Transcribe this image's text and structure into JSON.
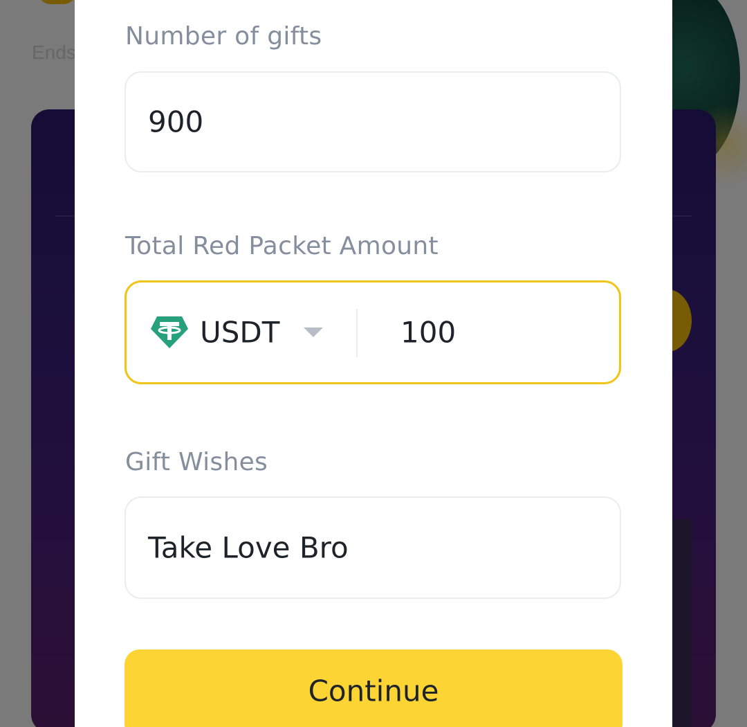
{
  "background": {
    "ends_text": "Ends"
  },
  "form": {
    "gifts": {
      "label": "Number of gifts",
      "value": "900"
    },
    "amount": {
      "label": "Total Red Packet Amount",
      "token": "USDT",
      "token_icon": "tether-icon",
      "value": "100",
      "accent_color": "#f0c419"
    },
    "wishes": {
      "label": "Gift Wishes",
      "value": "Take Love Bro"
    },
    "continue_label": "Continue",
    "continue_color": "#fcd535"
  }
}
